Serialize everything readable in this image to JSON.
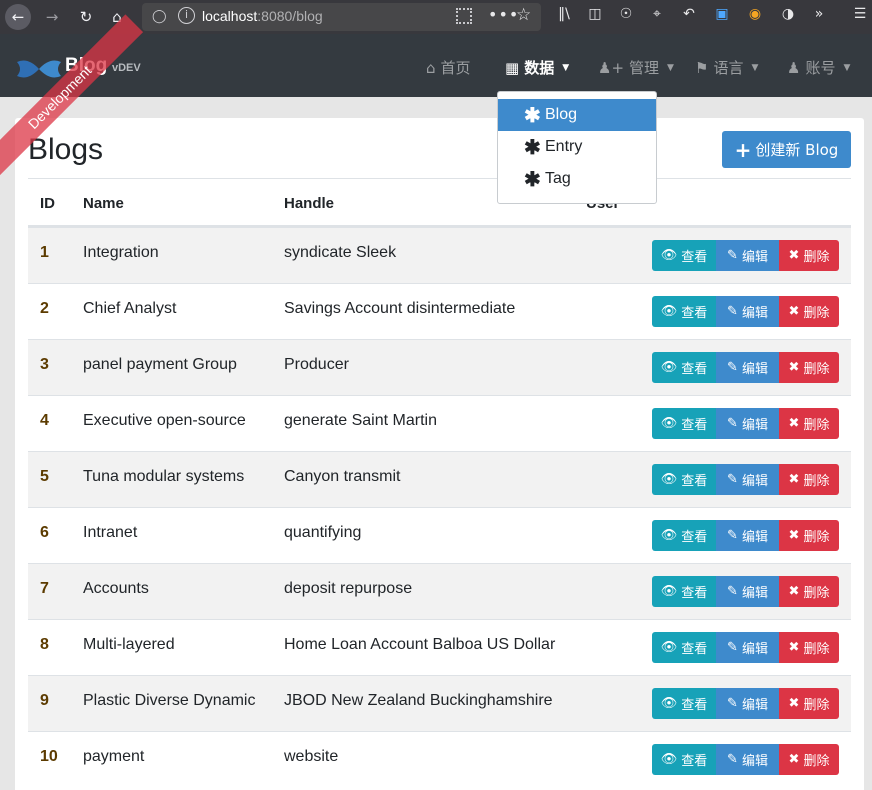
{
  "browser": {
    "url_host": "localhost",
    "url_rest": ":8080/blog"
  },
  "navbar": {
    "brand": "Blog",
    "version": "vDEV",
    "ribbon": "Development",
    "items": [
      {
        "label": "首页",
        "icon": "home-icon"
      },
      {
        "label": "数据",
        "icon": "table-icon"
      },
      {
        "label": "管理",
        "icon": "user-plus-icon"
      },
      {
        "label": "语言",
        "icon": "flag-icon"
      },
      {
        "label": "账号",
        "icon": "user-icon"
      }
    ]
  },
  "dropdown": {
    "items": [
      "Blog",
      "Entry",
      "Tag"
    ]
  },
  "page": {
    "title": "Blogs",
    "create_button": "创建新 Blog"
  },
  "table": {
    "headers": [
      "ID",
      "Name",
      "Handle",
      "User"
    ],
    "actions": {
      "view": "查看",
      "edit": "编辑",
      "delete": "删除"
    },
    "rows": [
      {
        "id": "1",
        "name": "Integration",
        "handle": "syndicate Sleek"
      },
      {
        "id": "2",
        "name": "Chief Analyst",
        "handle": "Savings Account disintermediate"
      },
      {
        "id": "3",
        "name": "panel payment Group",
        "handle": "Producer"
      },
      {
        "id": "4",
        "name": "Executive open-source",
        "handle": "generate Saint Martin"
      },
      {
        "id": "5",
        "name": "Tuna modular systems",
        "handle": "Canyon transmit"
      },
      {
        "id": "6",
        "name": "Intranet",
        "handle": "quantifying"
      },
      {
        "id": "7",
        "name": "Accounts",
        "handle": "deposit repurpose"
      },
      {
        "id": "8",
        "name": "Multi-layered",
        "handle": "Home Loan Account Balboa US Dollar"
      },
      {
        "id": "9",
        "name": "Plastic Diverse Dynamic",
        "handle": "JBOD New Zealand Buckinghamshire"
      },
      {
        "id": "10",
        "name": "payment",
        "handle": "website"
      }
    ]
  }
}
